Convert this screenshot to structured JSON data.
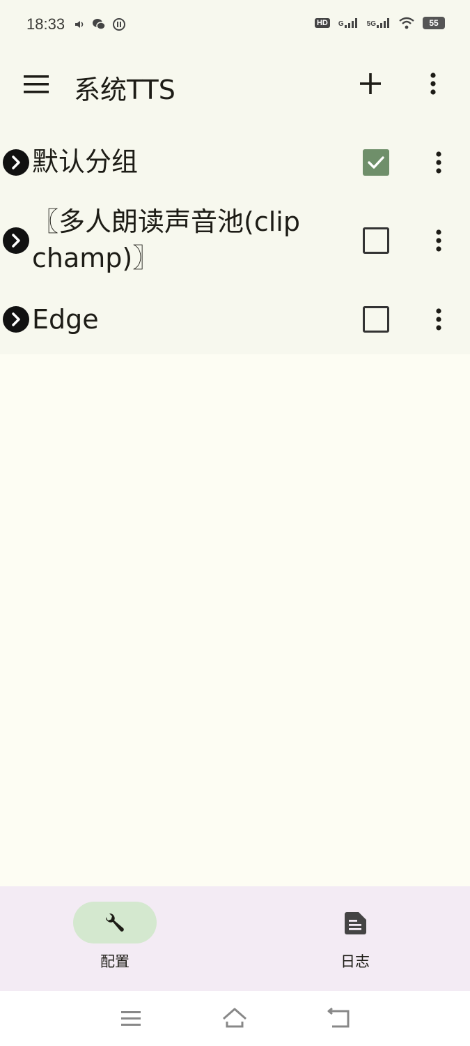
{
  "status_bar": {
    "time": "18:33",
    "hd_badge": "HD",
    "signal1_label": "G",
    "signal2_label": "5G",
    "battery": "55",
    "left_icons": [
      "volume-icon",
      "wechat-icon",
      "app-notification-icon"
    ],
    "right_icons": [
      "hd-icon",
      "signal-icon",
      "signal-5g-icon",
      "wifi-icon",
      "battery-icon"
    ]
  },
  "app_bar": {
    "title": "系统TTS",
    "icons": [
      "menu-icon",
      "add-icon",
      "more-vert-icon"
    ]
  },
  "groups": [
    {
      "name": "默认分组",
      "checked": true
    },
    {
      "name": "〖多人朗读声音池(clipchamp)〗",
      "checked": false
    },
    {
      "name": "Edge",
      "checked": false
    }
  ],
  "bottom_nav": {
    "items": [
      {
        "label": "配置",
        "icon": "wrench-icon",
        "active": true
      },
      {
        "label": "日志",
        "icon": "document-icon",
        "active": false
      }
    ]
  },
  "system_nav": {
    "icons": [
      "recents-icon",
      "home-icon",
      "back-icon"
    ]
  },
  "colors": {
    "background": "#fdfdf3",
    "bar_background": "#f7f8ee",
    "checked": "#6f8f6a",
    "nav_background": "#f3ebf4",
    "nav_active_pill": "#d4e8cf"
  }
}
